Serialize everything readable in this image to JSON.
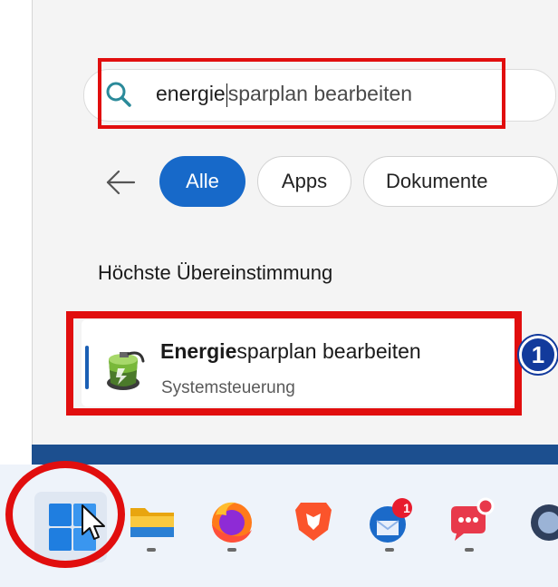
{
  "search": {
    "typed_text": "energie",
    "completion_text": "sparplan bearbeiten"
  },
  "filters": {
    "all_label": "Alle",
    "apps_label": "Apps",
    "documents_label": "Dokumente"
  },
  "best_match": {
    "section_title": "Höchste Übereinstimmung",
    "title_bold": "Energie",
    "title_rest": "sparplan bearbeiten",
    "subtitle": "Systemsteuerung",
    "step_number": "1"
  },
  "taskbar": {
    "icons": [
      "windows-start",
      "file-explorer",
      "firefox",
      "brave",
      "thunderbird",
      "chat-app"
    ],
    "badges": {
      "thunderbird": "1"
    }
  },
  "colors": {
    "accent": "#1769c9",
    "highlight": "#e10e0e",
    "step_badge": "#123a9c"
  }
}
